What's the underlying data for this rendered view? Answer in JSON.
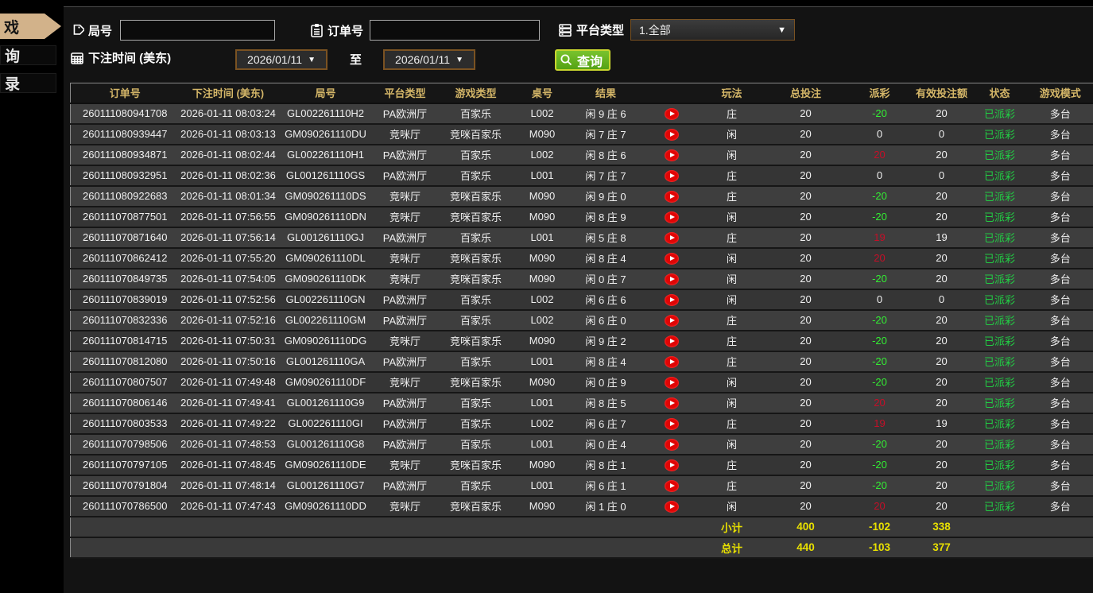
{
  "sidebar": {
    "tabs": [
      {
        "label": "戏",
        "active": true
      },
      {
        "label": "询",
        "active": false
      },
      {
        "label": "录",
        "active": false
      }
    ]
  },
  "filters": {
    "round": {
      "label": "局号",
      "value": ""
    },
    "order": {
      "label": "订单号",
      "value": ""
    },
    "platform": {
      "label": "平台类型",
      "selected": "1.全部"
    },
    "bet_time": {
      "label": "下注时间 (美东)",
      "from": "2026/01/11",
      "to_separator": "至",
      "to": "2026/01/11"
    },
    "search_button": {
      "label": "查询"
    },
    "caret": "▼"
  },
  "table": {
    "headers": [
      "订单号",
      "下注时间 (美东)",
      "局号",
      "平台类型",
      "游戏类型",
      "桌号",
      "结果",
      "",
      "玩法",
      "总投注",
      "派彩",
      "有效投注额",
      "状态",
      "游戏模式"
    ],
    "rows": [
      {
        "order": "260111080941708",
        "time": "2026-01-11 08:03:24",
        "round": "GL002261110H2",
        "platform": "PA欧洲厅",
        "game": "百家乐",
        "table_no": "L002",
        "result": "闲 9 庄 6",
        "bet": "庄",
        "total": "20",
        "payout": "-20",
        "valid": "20",
        "status": "已派彩",
        "mode": "多台"
      },
      {
        "order": "260111080939447",
        "time": "2026-01-11 08:03:13",
        "round": "GM090261110DU",
        "platform": "竞咪厅",
        "game": "竞咪百家乐",
        "table_no": "M090",
        "result": "闲 7 庄 7",
        "bet": "闲",
        "total": "20",
        "payout": "0",
        "valid": "0",
        "status": "已派彩",
        "mode": "多台"
      },
      {
        "order": "260111080934871",
        "time": "2026-01-11 08:02:44",
        "round": "GL002261110H1",
        "platform": "PA欧洲厅",
        "game": "百家乐",
        "table_no": "L002",
        "result": "闲 8 庄 6",
        "bet": "闲",
        "total": "20",
        "payout": "20",
        "valid": "20",
        "status": "已派彩",
        "mode": "多台"
      },
      {
        "order": "260111080932951",
        "time": "2026-01-11 08:02:36",
        "round": "GL001261110GS",
        "platform": "PA欧洲厅",
        "game": "百家乐",
        "table_no": "L001",
        "result": "闲 7 庄 7",
        "bet": "庄",
        "total": "20",
        "payout": "0",
        "valid": "0",
        "status": "已派彩",
        "mode": "多台"
      },
      {
        "order": "260111080922683",
        "time": "2026-01-11 08:01:34",
        "round": "GM090261110DS",
        "platform": "竞咪厅",
        "game": "竞咪百家乐",
        "table_no": "M090",
        "result": "闲 9 庄 0",
        "bet": "庄",
        "total": "20",
        "payout": "-20",
        "valid": "20",
        "status": "已派彩",
        "mode": "多台"
      },
      {
        "order": "260111070877501",
        "time": "2026-01-11 07:56:55",
        "round": "GM090261110DN",
        "platform": "竞咪厅",
        "game": "竞咪百家乐",
        "table_no": "M090",
        "result": "闲 8 庄 9",
        "bet": "闲",
        "total": "20",
        "payout": "-20",
        "valid": "20",
        "status": "已派彩",
        "mode": "多台"
      },
      {
        "order": "260111070871640",
        "time": "2026-01-11 07:56:14",
        "round": "GL001261110GJ",
        "platform": "PA欧洲厅",
        "game": "百家乐",
        "table_no": "L001",
        "result": "闲 5 庄 8",
        "bet": "庄",
        "total": "20",
        "payout": "19",
        "valid": "19",
        "status": "已派彩",
        "mode": "多台"
      },
      {
        "order": "260111070862412",
        "time": "2026-01-11 07:55:20",
        "round": "GM090261110DL",
        "platform": "竞咪厅",
        "game": "竞咪百家乐",
        "table_no": "M090",
        "result": "闲 8 庄 4",
        "bet": "闲",
        "total": "20",
        "payout": "20",
        "valid": "20",
        "status": "已派彩",
        "mode": "多台"
      },
      {
        "order": "260111070849735",
        "time": "2026-01-11 07:54:05",
        "round": "GM090261110DK",
        "platform": "竞咪厅",
        "game": "竞咪百家乐",
        "table_no": "M090",
        "result": "闲 0 庄 7",
        "bet": "闲",
        "total": "20",
        "payout": "-20",
        "valid": "20",
        "status": "已派彩",
        "mode": "多台"
      },
      {
        "order": "260111070839019",
        "time": "2026-01-11 07:52:56",
        "round": "GL002261110GN",
        "platform": "PA欧洲厅",
        "game": "百家乐",
        "table_no": "L002",
        "result": "闲 6 庄 6",
        "bet": "闲",
        "total": "20",
        "payout": "0",
        "valid": "0",
        "status": "已派彩",
        "mode": "多台"
      },
      {
        "order": "260111070832336",
        "time": "2026-01-11 07:52:16",
        "round": "GL002261110GM",
        "platform": "PA欧洲厅",
        "game": "百家乐",
        "table_no": "L002",
        "result": "闲 6 庄 0",
        "bet": "庄",
        "total": "20",
        "payout": "-20",
        "valid": "20",
        "status": "已派彩",
        "mode": "多台"
      },
      {
        "order": "260111070814715",
        "time": "2026-01-11 07:50:31",
        "round": "GM090261110DG",
        "platform": "竞咪厅",
        "game": "竞咪百家乐",
        "table_no": "M090",
        "result": "闲 9 庄 2",
        "bet": "庄",
        "total": "20",
        "payout": "-20",
        "valid": "20",
        "status": "已派彩",
        "mode": "多台"
      },
      {
        "order": "260111070812080",
        "time": "2026-01-11 07:50:16",
        "round": "GL001261110GA",
        "platform": "PA欧洲厅",
        "game": "百家乐",
        "table_no": "L001",
        "result": "闲 8 庄 4",
        "bet": "庄",
        "total": "20",
        "payout": "-20",
        "valid": "20",
        "status": "已派彩",
        "mode": "多台"
      },
      {
        "order": "260111070807507",
        "time": "2026-01-11 07:49:48",
        "round": "GM090261110DF",
        "platform": "竞咪厅",
        "game": "竞咪百家乐",
        "table_no": "M090",
        "result": "闲 0 庄 9",
        "bet": "闲",
        "total": "20",
        "payout": "-20",
        "valid": "20",
        "status": "已派彩",
        "mode": "多台"
      },
      {
        "order": "260111070806146",
        "time": "2026-01-11 07:49:41",
        "round": "GL001261110G9",
        "platform": "PA欧洲厅",
        "game": "百家乐",
        "table_no": "L001",
        "result": "闲 8 庄 5",
        "bet": "闲",
        "total": "20",
        "payout": "20",
        "valid": "20",
        "status": "已派彩",
        "mode": "多台"
      },
      {
        "order": "260111070803533",
        "time": "2026-01-11 07:49:22",
        "round": "GL002261110GI",
        "platform": "PA欧洲厅",
        "game": "百家乐",
        "table_no": "L002",
        "result": "闲 6 庄 7",
        "bet": "庄",
        "total": "20",
        "payout": "19",
        "valid": "19",
        "status": "已派彩",
        "mode": "多台"
      },
      {
        "order": "260111070798506",
        "time": "2026-01-11 07:48:53",
        "round": "GL001261110G8",
        "platform": "PA欧洲厅",
        "game": "百家乐",
        "table_no": "L001",
        "result": "闲 0 庄 4",
        "bet": "闲",
        "total": "20",
        "payout": "-20",
        "valid": "20",
        "status": "已派彩",
        "mode": "多台"
      },
      {
        "order": "260111070797105",
        "time": "2026-01-11 07:48:45",
        "round": "GM090261110DE",
        "platform": "竞咪厅",
        "game": "竞咪百家乐",
        "table_no": "M090",
        "result": "闲 8 庄 1",
        "bet": "庄",
        "total": "20",
        "payout": "-20",
        "valid": "20",
        "status": "已派彩",
        "mode": "多台"
      },
      {
        "order": "260111070791804",
        "time": "2026-01-11 07:48:14",
        "round": "GL001261110G7",
        "platform": "PA欧洲厅",
        "game": "百家乐",
        "table_no": "L001",
        "result": "闲 6 庄 1",
        "bet": "庄",
        "total": "20",
        "payout": "-20",
        "valid": "20",
        "status": "已派彩",
        "mode": "多台"
      },
      {
        "order": "260111070786500",
        "time": "2026-01-11 07:47:43",
        "round": "GM090261110DD",
        "platform": "竞咪厅",
        "game": "竞咪百家乐",
        "table_no": "M090",
        "result": "闲 1 庄 0",
        "bet": "闲",
        "total": "20",
        "payout": "20",
        "valid": "20",
        "status": "已派彩",
        "mode": "多台"
      }
    ],
    "subtotal": {
      "label": "小计",
      "total": "400",
      "payout": "-102",
      "valid": "338"
    },
    "grand_total": {
      "label": "总计",
      "total": "440",
      "payout": "-103",
      "valid": "377"
    }
  },
  "colors": {
    "header_gold": "#d4b668",
    "summary_yellow": "#e8e000",
    "loss_green": "#33ee33",
    "win_red": "#c40f28",
    "status_green": "#22cc44",
    "active_tab_tan": "#d2b28a",
    "search_green": "#55a214",
    "filter_border_brown": "#7a5222"
  }
}
